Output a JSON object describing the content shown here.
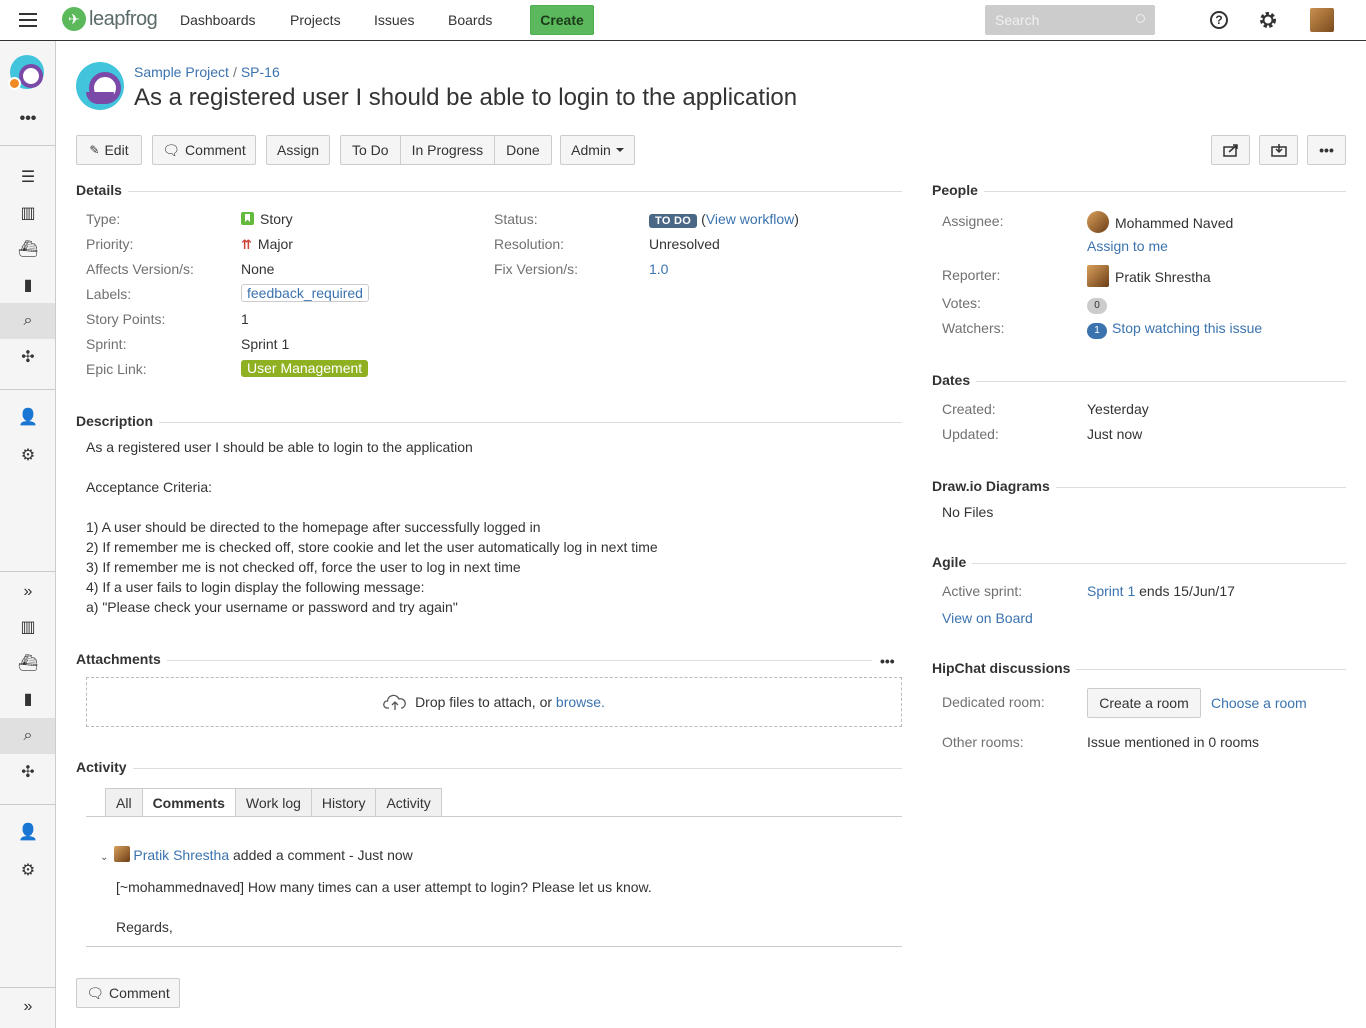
{
  "nav": {
    "logo_text": "leapfrog",
    "items": [
      "Dashboards",
      "Projects",
      "Issues",
      "Boards"
    ],
    "create_label": "Create",
    "search_placeholder": "Search",
    "help_label": "?"
  },
  "sidebar": {
    "more_label": "•••",
    "collapse_label": "»"
  },
  "breadcrumb": {
    "project": "Sample Project",
    "separator": "/",
    "issue_key": "SP-16"
  },
  "issue": {
    "title": "As a registered user I should be able to login to the application"
  },
  "toolbar": {
    "edit": "Edit",
    "comment": "Comment",
    "assign": "Assign",
    "workflow": [
      "To Do",
      "In Progress",
      "Done"
    ],
    "admin": "Admin"
  },
  "details": {
    "heading": "Details",
    "left": [
      {
        "label": "Type:",
        "value": "Story"
      },
      {
        "label": "Priority:",
        "value": "Major"
      },
      {
        "label": "Affects Version/s:",
        "value": "None"
      },
      {
        "label": "Labels:",
        "value": "feedback_required"
      },
      {
        "label": "Story Points:",
        "value": "1"
      },
      {
        "label": "Sprint:",
        "value": "Sprint 1"
      },
      {
        "label": "Epic Link:",
        "value": "User Management"
      }
    ],
    "right": [
      {
        "label": "Status:",
        "value": "TO DO",
        "extra_open": "(",
        "extra": "View workflow",
        "extra_close": ")"
      },
      {
        "label": "Resolution:",
        "value": "Unresolved"
      },
      {
        "label": "Fix Version/s:",
        "value": "1.0"
      }
    ]
  },
  "description": {
    "heading": "Description",
    "lines": [
      "As a registered user I should be able to login to the application",
      "",
      "Acceptance Criteria:",
      "",
      "1) A user should be directed to the homepage after successfully logged in",
      "2) If remember me is checked off, store cookie and let the user automatically log in next time",
      "3) If remember me is not checked off, force the user to log in next time",
      "4) If a user fails to login display the following message:",
      "a) \"Please check your username or password and try again\""
    ]
  },
  "attachments": {
    "heading": "Attachments",
    "more": "•••",
    "drop_text": "Drop files to attach, or",
    "browse": "browse."
  },
  "activity": {
    "heading": "Activity",
    "tabs": [
      "All",
      "Comments",
      "Work log",
      "History",
      "Activity"
    ],
    "active_tab": "Comments",
    "comment": {
      "author": "Pratik Shrestha",
      "action": "added a comment - Just now",
      "body": "[~mohammednaved] How many times can a user attempt to login? Please let us know.",
      "signoff": "Regards,"
    },
    "comment_button": "Comment"
  },
  "people": {
    "heading": "People",
    "assignee_label": "Assignee:",
    "assignee": "Mohammed Naved",
    "assign_to_me": "Assign to me",
    "reporter_label": "Reporter:",
    "reporter": "Pratik Shrestha",
    "votes_label": "Votes:",
    "votes": "0",
    "watchers_label": "Watchers:",
    "watchers": "1",
    "watch_link": "Stop watching this issue"
  },
  "dates": {
    "heading": "Dates",
    "created_label": "Created:",
    "created": "Yesterday",
    "updated_label": "Updated:",
    "updated": "Just now"
  },
  "drawio": {
    "heading": "Draw.io Diagrams",
    "value": "No Files"
  },
  "agile": {
    "heading": "Agile",
    "active_label": "Active sprint:",
    "sprint": "Sprint 1",
    "ends": "ends 15/Jun/17",
    "view_board": "View on Board"
  },
  "hipchat": {
    "heading": "HipChat discussions",
    "dedicated_label": "Dedicated room:",
    "create_room": "Create a room",
    "choose_room": "Choose a room",
    "other_label": "Other rooms:",
    "other_value": "Issue mentioned in 0 rooms"
  },
  "colors": {
    "accent": "#3b73af",
    "create": "#5cb85c",
    "epic": "#8eb021",
    "status": "#4a6785"
  }
}
